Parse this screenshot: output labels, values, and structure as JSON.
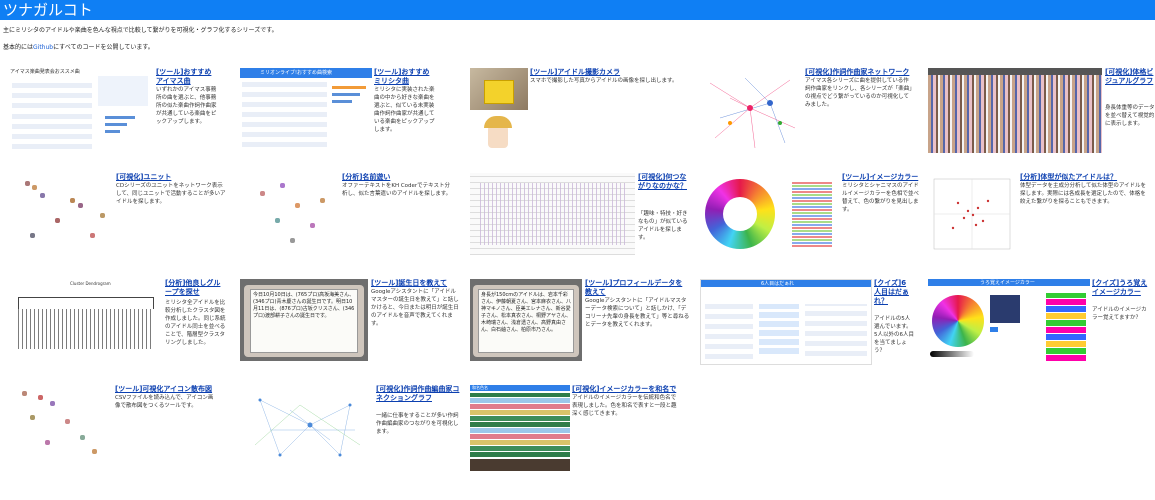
{
  "header": {
    "title": "ツナガルコト"
  },
  "intro": {
    "line1": "主にミリシタのアイドルや楽曲を色んな視点で比較して繋がりを可視化・グラフ化するシリーズです。",
    "line2_prefix": "基本的には",
    "line2_link": "Github",
    "line2_suffix": "にすべてのコードを公開しています。"
  },
  "cards": [
    {
      "title": "[ツール]おすすめアイマス曲",
      "desc": "いずれかのアイマス事務所の曲を選ぶと、他事務所の似た楽曲作詞作曲家が共通している楽曲をピックアップします。"
    },
    {
      "title": "[ツール]おすすめミリシタ曲",
      "desc": "ミリシタに実装された楽曲の中から好きな楽曲を選ぶと、似ている未実装曲作詞作曲家が共通している楽曲をピックアップします。"
    },
    {
      "title": "[ツール]アイドル撮影カメラ",
      "desc": "スマホで撮影した写真からアイドルの画像を探し出します。"
    },
    {
      "title": "[可視化]作詞作曲家ネットワーク",
      "desc": "アイマス各シリーズに曲を提供している作詞作曲家をリンクし、各シリーズが「楽曲」の視点でどう繋がっているのか可視化してみました。"
    },
    {
      "title": "[可視化]体格ビジュアルグラフ",
      "desc": "身長体重等のデータを並べ替えて視覚的に表示します。"
    },
    {
      "title": "[可視化]ユニット",
      "desc": "CDシリーズのユニットをネットワーク表示して、同じユニットで活動することが多いアイドルを探します。"
    },
    {
      "title": "[分析]名前遊い",
      "desc": "オファーテキストをKH Coderでテキスト分析し、似た言葉遣いのアイドルを探します。"
    },
    {
      "title": "[可視化]何つながりなのかな？",
      "desc": "「趣味・特技・好きなもの」が似ているアイドルを探します。"
    },
    {
      "title": "[ツール]イメージカラー",
      "desc": "ミリシタとシャニマスのアイドルイメージカラーを色相で並べ替えて、色の繋がりを見出します。"
    },
    {
      "title": "[分析]体型が似たアイドルは？",
      "desc": "体型データを主成分分析して似た体型のアイドルを探します。実際には各成長を選定したので、体格を絞えた繋がりを探ることもできます。"
    },
    {
      "title": "[分析]他良しグループを探せ",
      "desc": "ミリシタ全アイドルを比較分析したクラスタ図を作成しました。同じ系統のアイドル同士を並べることで、階層型クラスタリングしました。"
    },
    {
      "title": "[ツール]誕生日を教えて",
      "desc": "Googleアシスタントに「アイドルマスターの誕生日を教えて」と話しかけると、今日または明日が誕生日のアイドルを音声で教えてくれます。"
    },
    {
      "title": "[ツール]プロフィールデータを教えて",
      "desc": "Googleアシスタントに「アイドルマスターデータ検索について」と話しかけ、「デコリーナ先輩の身長を教えて」等と尋ねるとデータを教えてくれます。"
    },
    {
      "title": "[クイズ]6人目はだぁれ？",
      "desc": "アイドルの5人選んでいます。5人以外の6人目を当てましょう？"
    },
    {
      "title": "[クイズ]うろ覚えイメージカラー",
      "desc": "アイドルのイメージカラー覚えてますか？"
    },
    {
      "title": "[ツール]可視化アイコン散布図",
      "desc": "CSVファイルを読み込んで、アイコン画像で散布図をつくるツールです。"
    },
    {
      "title": "[可視化]作詞作曲編曲家コネクショングラフ",
      "desc": "一緒に仕事をすることが多い作詞作曲編曲家のつながりを可視化します。"
    },
    {
      "title": "[可視化]イメージカラーを和名で",
      "desc": "アイドルのイメージカラーを伝統和色名で表現しました。色を和名で表すと一段と趣深く感じてきます。"
    }
  ],
  "thumbs": {
    "t1_header": "アイマス楽曲発表会おススメ曲",
    "t2_header": "ミリオンライブ!おすすめ曲検索",
    "t12_text": "今日10月10日は、(765プロ)高坂海美さん、(346プロ)青木慶さんの誕生日です。明日10月11日は、(876プロ)古坂クリスさん、(346プロ)渡部耕子さんの誕生日です。",
    "t13_text": "身長が150cmのアイドルは、岩本千彩さん、伊藤朝夏さん、宮本麻衣さん、八神マキノさん、臣美エレナさん、新谷愛子さん、松本真衣さん、桐野アヤさん、木崎瑞さん、浅倉透さん、高野真由さん、白石紬さん、柏原市乃さん。",
    "t14_header": "6人目はだぁれ",
    "t15_header": "うろ覚えイメージカラー",
    "t18_header": "和名色名"
  },
  "colors": {
    "header_bg": "#0f7ff4",
    "link": "#0b3fb0"
  }
}
